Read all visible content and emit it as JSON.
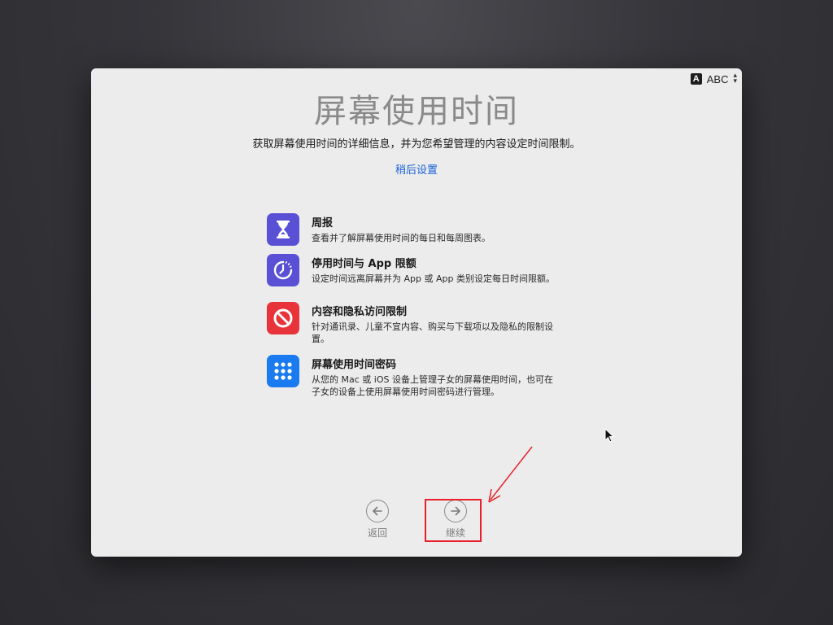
{
  "input_menu": {
    "badge": "A",
    "label": "ABC"
  },
  "page": {
    "title": "屏幕使用时间",
    "subtitle": "获取屏幕使用时间的详细信息，并为您希望管理的内容设定时间限制。",
    "later_link": "稍后设置"
  },
  "features": [
    {
      "name": "周报",
      "desc": "查看并了解屏幕使用时间的每日和每周图表。",
      "icon": "hourglass-icon",
      "color": "#5a50d6"
    },
    {
      "name": "停用时间与 App 限额",
      "desc": "设定时间远离屏幕并为 App 或 App 类别设定每日时间限额。",
      "icon": "downtime-icon",
      "color": "#5a50d6"
    },
    {
      "name": "内容和隐私访问限制",
      "desc": "针对通讯录、儿童不宜内容、购买与下载项以及隐私的限制设置。",
      "icon": "prohibited-icon",
      "color": "#e8333a"
    },
    {
      "name": "屏幕使用时间密码",
      "desc": "从您的 Mac 或 iOS 设备上管理子女的屏幕使用时间，也可在子女的设备上使用屏幕使用时间密码进行管理。",
      "icon": "keypad-icon",
      "color": "#1a7af0"
    }
  ],
  "nav": {
    "back_label": "返回",
    "continue_label": "继续"
  },
  "colors": {
    "highlight": "#e8202a",
    "link": "#1a62d8"
  }
}
